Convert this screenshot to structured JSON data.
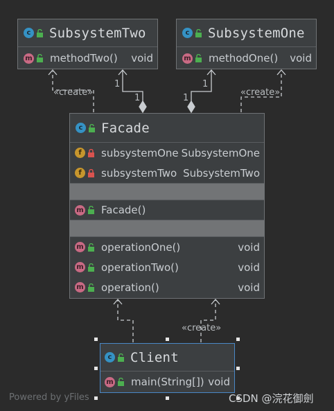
{
  "classes": {
    "subsystem_two": {
      "name": "SubsystemTwo",
      "members": [
        {
          "kind": "m",
          "name": "methodTwo()",
          "type": "void"
        }
      ]
    },
    "subsystem_one": {
      "name": "SubsystemOne",
      "members": [
        {
          "kind": "m",
          "name": "methodOne()",
          "type": "void"
        }
      ]
    },
    "facade": {
      "name": "Facade",
      "fields": [
        {
          "kind": "f",
          "name": "subsystemOne",
          "type": "SubsystemOne"
        },
        {
          "kind": "f",
          "name": "subsystemTwo",
          "type": "SubsystemTwo"
        }
      ],
      "constructor": {
        "kind": "m",
        "name": "Facade()"
      },
      "methods": [
        {
          "kind": "m",
          "name": "operationOne()",
          "type": "void"
        },
        {
          "kind": "m",
          "name": "operationTwo()",
          "type": "void"
        },
        {
          "kind": "m",
          "name": "operation()",
          "type": "void"
        }
      ]
    },
    "client": {
      "name": "Client",
      "members": [
        {
          "kind": "m",
          "name": "main(String[])",
          "type": "void"
        }
      ]
    }
  },
  "icons": {
    "class": "c",
    "method": "m",
    "field": "f"
  },
  "edges": {
    "create_label": "«create»",
    "multiplicity": "1"
  },
  "watermark": "Powered by yFiles",
  "credit": "CSDN @浣花御劍",
  "colors": {
    "background": "#2b2b2b",
    "box": "#3c3f41",
    "selected_border": "#4a88c7",
    "class_icon": "#3592c4",
    "method_icon": "#c96a84",
    "field_icon": "#c7962d",
    "public_green": "#4caf50",
    "private_red": "#d9534f"
  }
}
